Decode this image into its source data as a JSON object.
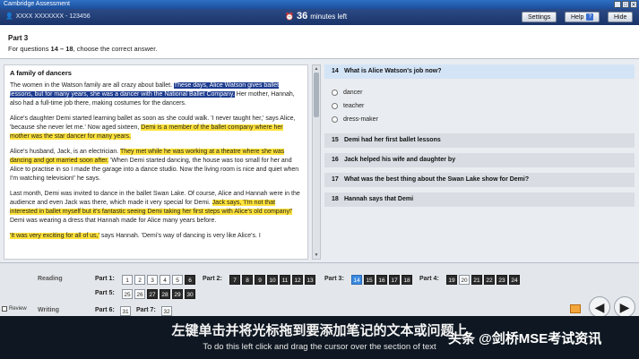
{
  "window": {
    "title": "Cambridge Assessment",
    "controls": [
      "_",
      "□",
      "✕"
    ]
  },
  "topbar": {
    "candidate": "XXXX XXXXXXX - 123456",
    "timer_value": "36",
    "timer_label": "minutes left",
    "settings_label": "Settings",
    "help_label": "Help",
    "hide_label": "Hide"
  },
  "instructions": {
    "part": "Part 3",
    "text_prefix": "For questions ",
    "range": "14 – 18",
    "text_suffix": ", choose the correct answer."
  },
  "passage": {
    "title": "A family of dancers",
    "p1": {
      "a": "The women in the Watson family are all crazy about ballet. ",
      "hl": "These days, Alice Watson gives ballet lessons, but for many years, she was a dancer with the National Ballet Company.",
      "b": " Her mother, Hannah, also had a full-time job there, making costumes for the dancers."
    },
    "p2": {
      "a": "Alice's daughter Demi started learning ballet as soon as she could walk. 'I never taught her,' says Alice, 'because she never let me.' Now aged sixteen, ",
      "hl": "Demi is a member of the ballet company where her mother was the star dancer for many years."
    },
    "p3": {
      "a": "Alice's husband, Jack, is an electrician. ",
      "hl": "They met while he was working at a theatre where she was dancing and got married soon after.",
      "b": " 'When Demi started dancing, the house was too small for her and Alice to practise in so I made the garage into a dance studio. Now the living room is nice and quiet when I'm watching television!' he says."
    },
    "p4": {
      "a": "Last month, Demi was invited to dance in the ballet Swan Lake. Of course, Alice and Hannah were in the audience and even Jack was there, which made it very special for Demi. ",
      "hl": "Jack says, 'I'm not that interested in ballet myself but it's fantastic seeing Demi taking her first steps with Alice's old company!'",
      "b": " Demi was wearing a dress that Hannah made for Alice many years before."
    },
    "p5": {
      "hl": "'It was very exciting for all of us,'",
      "b": " says Hannah. 'Demi's way of dancing is very like Alice's. I"
    }
  },
  "questions": [
    {
      "num": "14",
      "text": "What is Alice Watson's job now?",
      "options": [
        "dancer",
        "teacher",
        "dress-maker"
      ]
    },
    {
      "num": "15",
      "text": "Demi had her first ballet lessons"
    },
    {
      "num": "16",
      "text": "Jack helped his wife and daughter by"
    },
    {
      "num": "17",
      "text": "What was the best thing about the Swan Lake show for Demi?"
    },
    {
      "num": "18",
      "text": "Hannah says that Demi"
    }
  ],
  "nav": {
    "reading_label": "Reading",
    "writing_label": "Writing",
    "review_label": "Review",
    "part1_label": "Part 1:",
    "part1": [
      "1",
      "2",
      "3",
      "4",
      "5",
      "6"
    ],
    "part2_label": "Part 2:",
    "part2": [
      "7",
      "8",
      "9",
      "10",
      "11",
      "12",
      "13"
    ],
    "part3_label": "Part 3:",
    "part3": [
      "14",
      "15",
      "16",
      "17",
      "18"
    ],
    "part4_label": "Part 4:",
    "part4": [
      "19",
      "20",
      "21",
      "22",
      "23",
      "24"
    ],
    "part5_label": "Part 5:",
    "part5": [
      "25",
      "26",
      "27",
      "28",
      "29",
      "30"
    ],
    "part6_label": "Part 6:",
    "part6": [
      "31"
    ],
    "part7_label": "Part 7:",
    "part7": [
      "32"
    ],
    "prev_glyph": "◀",
    "next_glyph": "▶"
  },
  "subtitles": {
    "zh": "左键单击并将光标拖到要添加笔记的文本或问题上",
    "en": "To do this left click and drag the cursor over the section of text",
    "watermark": "头条 @剑桥MSE考试资讯"
  },
  "colors": {
    "highlight": "#ffe23a",
    "selection": "#1c3b8f",
    "current_question": "#3c8be0",
    "answered": "#2b2b2b"
  }
}
